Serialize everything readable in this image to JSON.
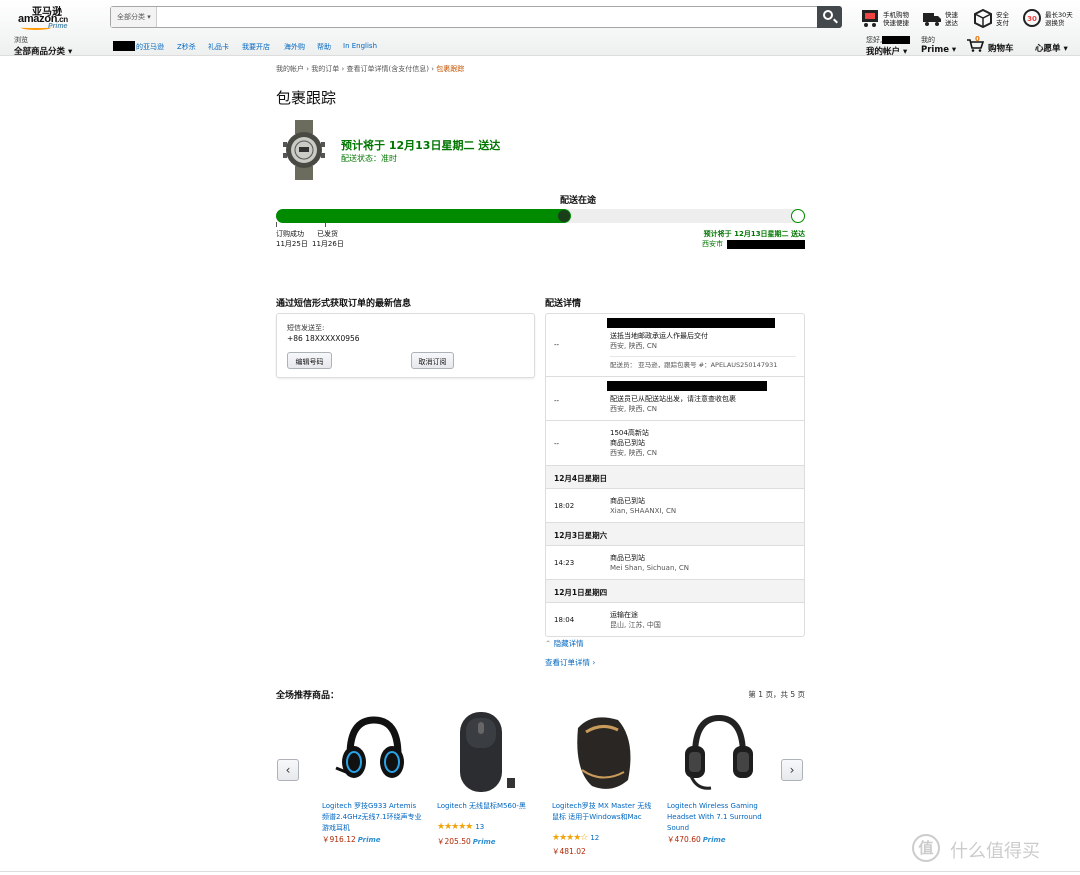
{
  "header": {
    "logo_cn": "亚马逊",
    "logo_en": "amazon",
    "logo_tld": ".cn",
    "logo_prime": "Prime",
    "search_category": "全部分类",
    "promos": [
      {
        "line1": "手机购物",
        "line2": "快速便捷"
      },
      {
        "line1": "快速",
        "line2": "送达"
      },
      {
        "line1": "安全",
        "line2": "支付"
      },
      {
        "line1": "最长30天",
        "line2": "退换货"
      }
    ],
    "browse_small": "浏览",
    "browse_big": "全部商品分类",
    "nav_links": [
      "的亚马逊",
      "Z秒杀",
      "礼品卡",
      "我要开店",
      "海外购",
      "帮助",
      "In English"
    ],
    "hello_small": "您好,",
    "account_big": "我的帐户",
    "prime_small": "我的",
    "prime_big": "Prime",
    "cart_count": "0",
    "cart_label": "购物车",
    "wishlist": "心愿单"
  },
  "breadcrumb": {
    "items": [
      "我的帐户",
      "我的订单",
      "查看订单详情(含支付信息)"
    ],
    "current": "包裹跟踪"
  },
  "page_title": "包裹跟踪",
  "delivery": {
    "eta": "预计将于 12月13日星期二 送达",
    "status": "配送状态：准时"
  },
  "progress": {
    "label": "配送在途",
    "fraction": 0.56,
    "stages": [
      {
        "name": "订购成功",
        "date": "11月25日"
      },
      {
        "name": "已发货",
        "date": "11月26日"
      }
    ],
    "end_label": "预计将于 12月13日星期二 送达",
    "end_city": "西安市"
  },
  "sms": {
    "title": "通过短信形式获取订单的最新信息",
    "send_to_label": "短信发送至:",
    "phone": "+86 18XXXXX0956",
    "edit_button": "编辑号码",
    "cancel_button": "取消订阅"
  },
  "details": {
    "title": "配送详情",
    "rows": [
      {
        "time": "--",
        "event": "送抵当地邮政承运人作最后交付",
        "loc": "西安, 陕西, CN",
        "extra": "配送员： 亚马逊，跟踪包裹号 #：APELAUS250147931"
      },
      {
        "time": "--",
        "event": "配送员已从配送站出发，请注意查收包裹",
        "loc": "西安, 陕西, CN"
      },
      {
        "time": "--",
        "event": "1504高新站",
        "event2": "商品已到站",
        "loc": "西安, 陕西, CN"
      }
    ],
    "groups": [
      {
        "date": "12月4日星期日",
        "time": "18:02",
        "event": "商品已到站",
        "loc": "Xian, SHAANXI, CN"
      },
      {
        "date": "12月3日星期六",
        "time": "14:23",
        "event": "商品已到站",
        "loc": "Mei Shan, Sichuan, CN"
      },
      {
        "date": "12月1日星期四",
        "time": "18:04",
        "event": "运输在途",
        "loc": "昆山, 江苏, 中国"
      }
    ],
    "hide_link": "隐藏详情",
    "view_order_link": "查看订单详情"
  },
  "recommendations": {
    "title": "全场推荐商品：",
    "page_info": "第 1 页，共 5 页",
    "products": [
      {
        "name": "Logitech 罗技G933 Artemis频谱2.4GHz无线7.1环绕声专业游戏耳机",
        "price": "￥916.12",
        "prime": "Prime",
        "stars": "",
        "reviews": ""
      },
      {
        "name": "Logitech 无线鼠标M560-黑",
        "price": "￥205.50",
        "prime": "Prime",
        "stars": "★★★★★",
        "reviews": "13"
      },
      {
        "name": "Logitech罗技 MX Master 无线鼠标 适用于Windows和Mac",
        "price": "￥481.02",
        "prime": "",
        "stars": "★★★★☆",
        "reviews": "12"
      },
      {
        "name": "Logitech Wireless Gaming Headset With 7.1 Surround Sound",
        "price": "￥470.60",
        "prime": "Prime",
        "stars": "",
        "reviews": ""
      }
    ]
  },
  "watermark": {
    "badge": "值",
    "text": "什么值得买"
  }
}
